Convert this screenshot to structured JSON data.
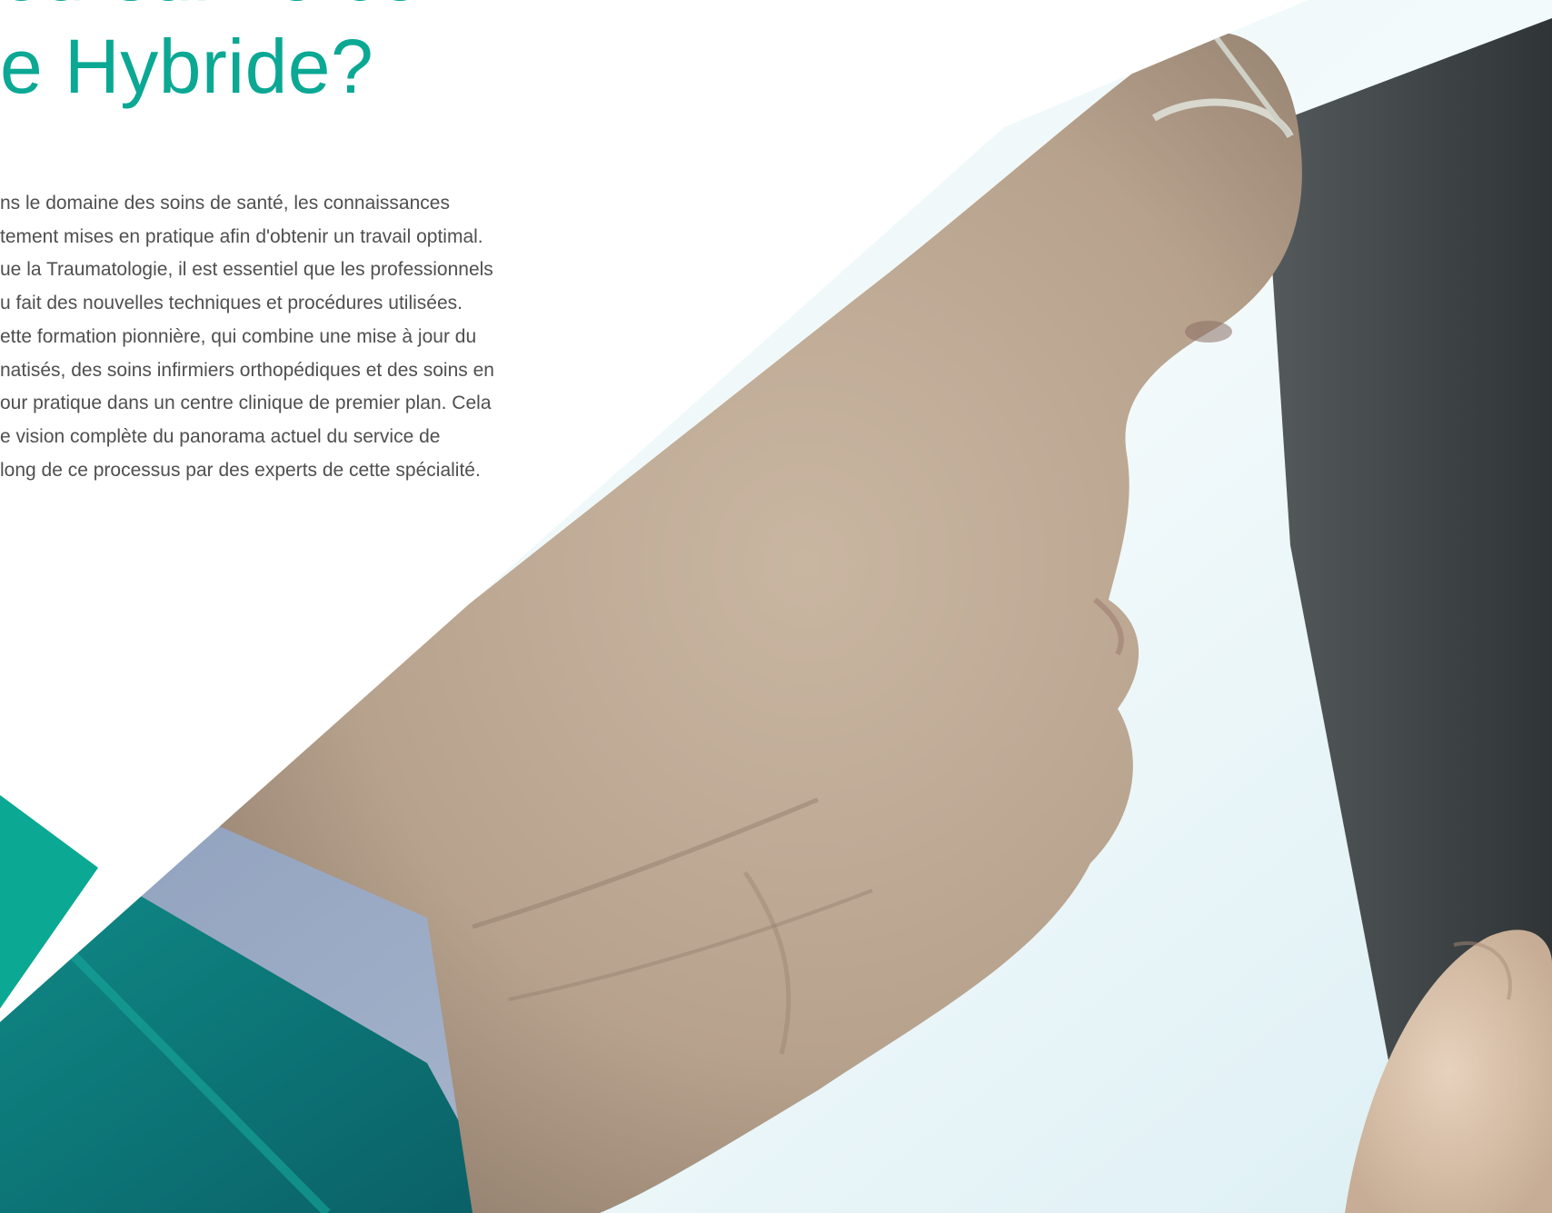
{
  "hero": {
    "title_lines": [
      "oursuivre ce",
      "e Hybride?"
    ],
    "paragraph_lines": [
      "ns le domaine des soins de santé, les connaissances",
      "tement mises en pratique afin d'obtenir un travail optimal.",
      "ue la Traumatologie, il est essentiel que les professionnels",
      "u fait des nouvelles techniques et procédures utilisées.",
      "ette formation pionnière, qui combine une mise à jour du",
      "natisés, des soins infirmiers orthopédiques et des soins en",
      "our pratique dans un centre clinique de premier plan. Cela",
      "e vision complète du panorama actuel du service de",
      "long de ce processus par des experts de cette spécialité."
    ]
  },
  "colors": {
    "accent_teal": "#0ba894",
    "dark_teal": "#0c6b70",
    "text_gray": "#4f4f4f"
  }
}
